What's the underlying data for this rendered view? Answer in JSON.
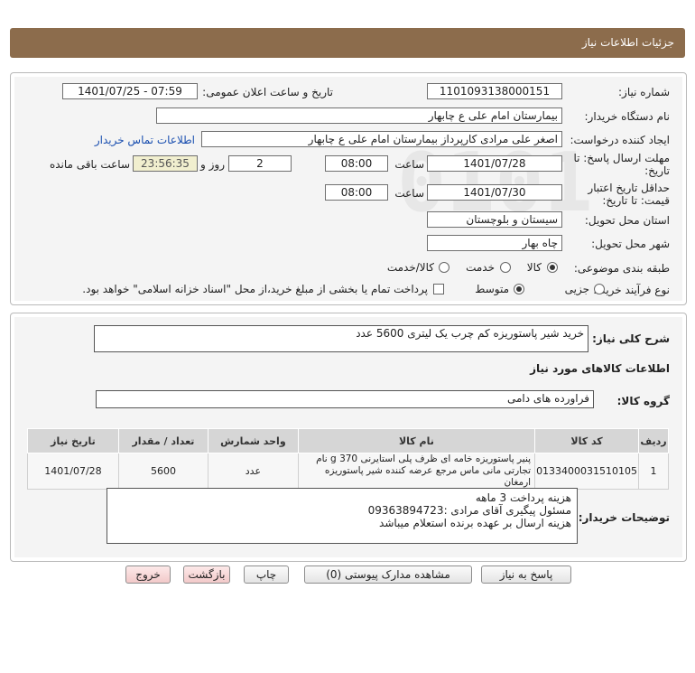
{
  "header": {
    "title": "جزئیات اطلاعات نیاز"
  },
  "watermark": {
    "brand": "ParsNamadData"
  },
  "form": {
    "need_number_label": "شماره نیاز:",
    "need_number": "1101093138000151",
    "announce_label": "تاریخ و ساعت اعلان عمومی:",
    "announce_value": "1401/07/25 - 07:59",
    "buyer_org_label": "نام دستگاه خریدار:",
    "buyer_org": "بیمارستان امام علی  ع  چابهار",
    "requester_label": "ایجاد کننده درخواست:",
    "requester": "اصغر علی مرادی کارپرداز بیمارستان امام علی  ع  چابهار",
    "contact_link": "اطلاعات تماس خریدار",
    "reply_deadline_label_1": "مهلت ارسال پاسخ: تا",
    "reply_deadline_label_2": "تاریخ:",
    "reply_date": "1401/07/28",
    "time_label": "ساعت",
    "reply_time": "08:00",
    "days_value": "2",
    "days_label": "روز و",
    "remaining_time": "23:56:35",
    "remaining_label": "ساعت باقی مانده",
    "validity_label_1": "حداقل تاریخ اعتبار",
    "validity_label_2": "قیمت: تا تاریخ:",
    "validity_date": "1401/07/30",
    "validity_time": "08:00",
    "province_label": "استان محل تحویل:",
    "province": "سیستان و بلوچستان",
    "city_label": "شهر محل تحویل:",
    "city": "چاه بهار",
    "category_label": "طبقه بندی موضوعی:",
    "category_options": [
      "کالا",
      "خدمت",
      "کالا/خدمت"
    ],
    "category_selected": "کالا",
    "process_label": "نوع فرآیند خرید :",
    "process_options": [
      "جزیی",
      "متوسط"
    ],
    "process_selected": "متوسط",
    "payment_note": "پرداخت تمام یا بخشی از مبلغ خرید،از محل \"اسناد خزانه اسلامی\" خواهد بود."
  },
  "need": {
    "summary_label": "شرح کلی نیاز:",
    "summary": "خرید شیر پاستوریزه کم چرب یک لیتری 5600 عدد",
    "goods_info_title": "اطلاعات کالاهای مورد نیاز",
    "group_label": "گروه کالا:",
    "group": "فراورده های دامی"
  },
  "table": {
    "headers": [
      "ردیف",
      "کد کالا",
      "نام کالا",
      "واحد شمارش",
      "تعداد / مقدار",
      "تاریخ نیاز"
    ],
    "rows": [
      {
        "row": "1",
        "code": "0133400031510105",
        "name": "پنیر پاستوریزه خامه ای ظرف پلی استایرنی 370 g نام تجارتی مانی ماس مرجع عرضه کننده شیر پاستوریزه ارمغان",
        "unit": "عدد",
        "qty": "5600",
        "date": "1401/07/28"
      }
    ]
  },
  "buyer_notes": {
    "label": "توضیحات خریدار:",
    "lines": [
      "هزینه پرداخت 3 ماهه",
      "مسئول پیگیری آقای مرادی :09363894723",
      "هزینه ارسال بر عهده برنده استعلام میباشد"
    ]
  },
  "buttons": {
    "reply": "پاسخ به نیاز",
    "attachments": "مشاهده مدارک پیوستی (0)",
    "print": "چاپ",
    "back": "بازگشت",
    "exit": "خروج"
  }
}
